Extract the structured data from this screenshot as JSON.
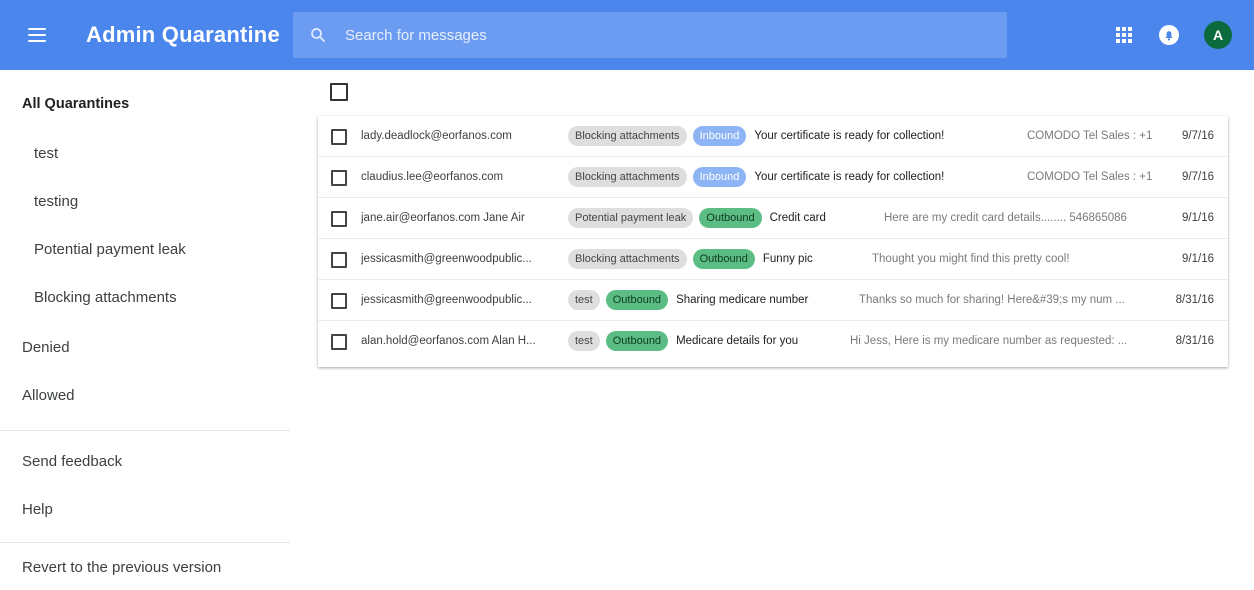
{
  "header": {
    "title": "Admin Quarantine",
    "search_placeholder": "Search for messages",
    "avatar_letter": "A",
    "colors": {
      "bar": "#4a86ec",
      "search": "#6c9cf2",
      "avatar": "#0c6b3c"
    }
  },
  "sidebar": {
    "items": [
      {
        "label": "All Quarantines"
      },
      {
        "label": "test"
      },
      {
        "label": "testing"
      },
      {
        "label": "Potential payment leak"
      },
      {
        "label": "Blocking attachments"
      },
      {
        "label": "Denied"
      },
      {
        "label": "Allowed"
      },
      {
        "label": "Send feedback"
      },
      {
        "label": "Help"
      },
      {
        "label": "Revert to the previous version"
      }
    ]
  },
  "messages": [
    {
      "sender": "lady.deadlock@eorfanos.com",
      "quarantine": "Blocking attachments",
      "direction": "Inbound",
      "subject": "Your certificate is ready for collection!",
      "snippet": "COMODO Tel Sales : +1",
      "date": "9/7/16"
    },
    {
      "sender": "claudius.lee@eorfanos.com",
      "quarantine": "Blocking attachments",
      "direction": "Inbound",
      "subject": "Your certificate is ready for collection!",
      "snippet": "COMODO Tel Sales : +1",
      "date": "9/7/16"
    },
    {
      "sender": "jane.air@eorfanos.com Jane Air",
      "quarantine": "Potential payment leak",
      "direction": "Outbound",
      "subject": "Credit card",
      "snippet": "Here are my credit card details........ 546865086",
      "date": "9/1/16"
    },
    {
      "sender": "jessicasmith@greenwoodpublic...",
      "quarantine": "Blocking attachments",
      "direction": "Outbound",
      "subject": "Funny pic",
      "snippet": "Thought you might find this pretty cool!",
      "date": "9/1/16"
    },
    {
      "sender": "jessicasmith@greenwoodpublic...",
      "quarantine": "test",
      "direction": "Outbound",
      "subject": "Sharing medicare number",
      "snippet": "Thanks so much for sharing! Here&#39;s my num ...",
      "date": "8/31/16"
    },
    {
      "sender": "alan.hold@eorfanos.com Alan H...",
      "quarantine": "test",
      "direction": "Outbound",
      "subject": "Medicare details for you",
      "snippet": "Hi Jess, Here is my medicare number as requested: ...",
      "date": "8/31/16"
    }
  ]
}
